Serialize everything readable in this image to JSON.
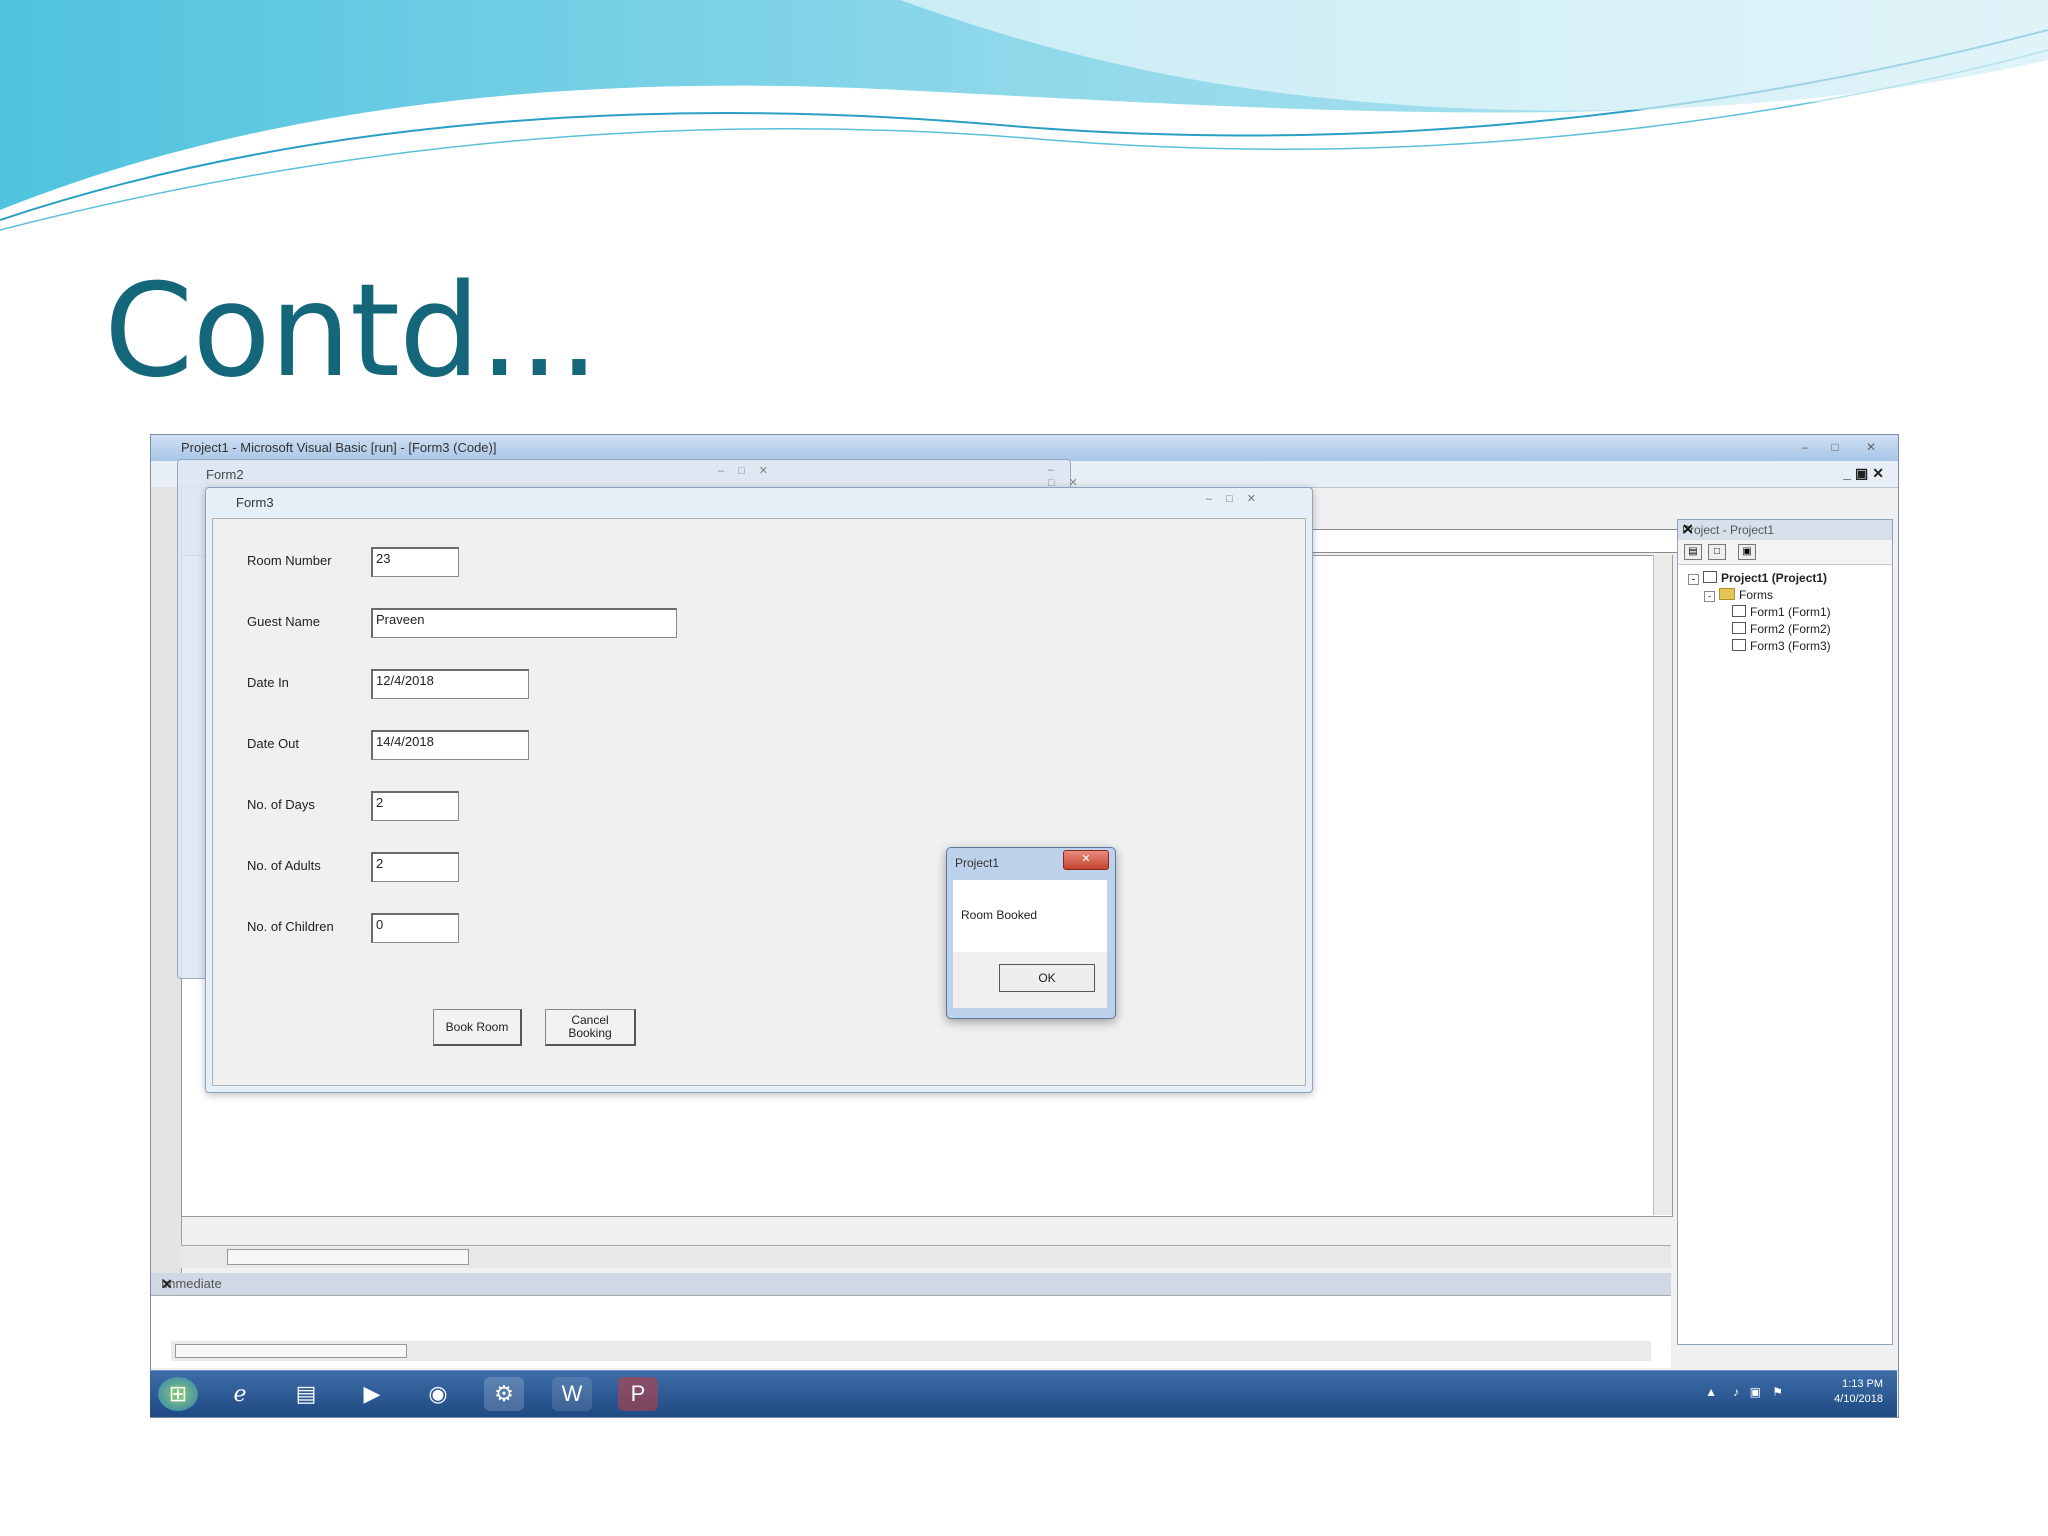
{
  "slide": {
    "title": "Contd..."
  },
  "vb": {
    "window_title": "Project1 - Microsoft Visual Basic [run] - [Form3 (Code)]",
    "immediate_label": "Immediate",
    "project_panel": {
      "title": "Project - Project1",
      "root": "Project1 (Project1)",
      "folder": "Forms",
      "forms": [
        "Form1 (Form1)",
        "Form2 (Form2)",
        "Form3 (Form3)"
      ]
    }
  },
  "form2": {
    "caption": "Form2"
  },
  "form3": {
    "caption": "Form3",
    "fields": [
      {
        "label": "Room Number",
        "value": "23"
      },
      {
        "label": "Guest Name",
        "value": "Praveen"
      },
      {
        "label": "Date In",
        "value": "12/4/2018"
      },
      {
        "label": "Date Out",
        "value": "14/4/2018"
      },
      {
        "label": "No. of Days",
        "value": "2"
      },
      {
        "label": "No. of Adults",
        "value": "2"
      },
      {
        "label": "No. of Children",
        "value": "0"
      }
    ],
    "book_button": "Book Room",
    "cancel_button_line1": "Cancel",
    "cancel_button_line2": "Booking"
  },
  "msgbox": {
    "caption": "Project1",
    "message": "Room Booked",
    "ok": "OK"
  },
  "taskbar": {
    "time": "1:13 PM",
    "date": "4/10/2018"
  },
  "colors": {
    "title": "#14677a",
    "wave_light": "#7fd3e8",
    "wave_dark": "#2a9fc4"
  }
}
